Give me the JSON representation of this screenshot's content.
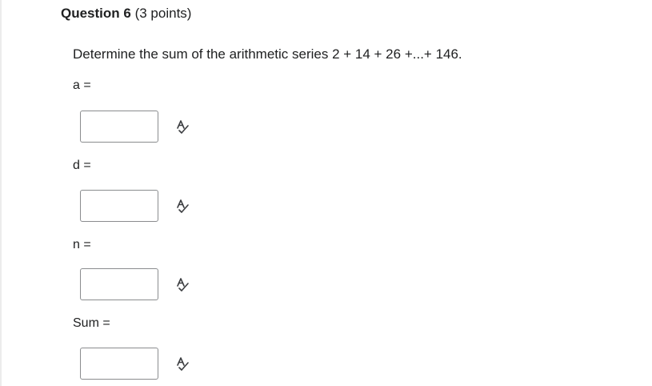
{
  "question": {
    "number_label": "Question 6",
    "points_label": "(3 points)",
    "prompt": "Determine the sum of the arithmetic series 2 + 14 + 26 +...+ 146."
  },
  "fields": [
    {
      "label": "a =",
      "value": "",
      "icon": "spellcheck-icon"
    },
    {
      "label": "d =",
      "value": "",
      "icon": "spellcheck-icon"
    },
    {
      "label": "n =",
      "value": "",
      "icon": "spellcheck-icon"
    },
    {
      "label": "Sum =",
      "value": "",
      "icon": "spellcheck-icon"
    }
  ],
  "colors": {
    "text": "#202122",
    "input_border": "#8a8c8e",
    "icon": "#3b3d40"
  }
}
